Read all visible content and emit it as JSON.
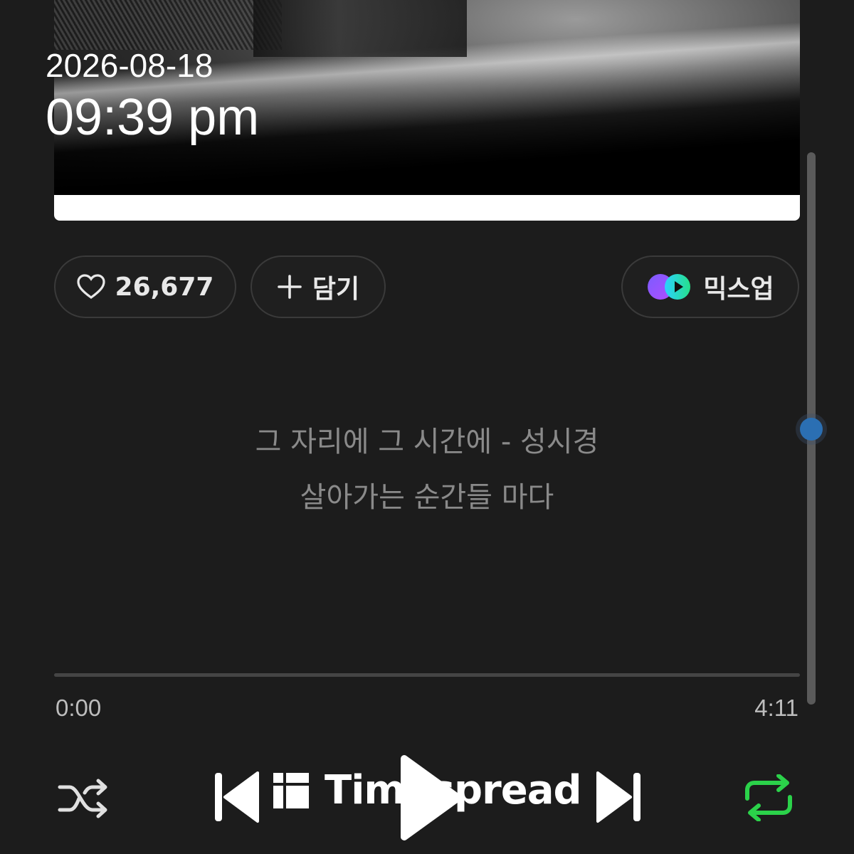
{
  "overlay": {
    "date": "2026-08-18",
    "time": "09:39 pm"
  },
  "actions": {
    "like_count": "26,677",
    "add_label": "담기",
    "mixup_label": "믹스업"
  },
  "lyrics": {
    "line1": "그 자리에 그 시간에 - 성시경",
    "line2": "살아가는 순간들 마다"
  },
  "progress": {
    "elapsed": "0:00",
    "duration": "4:11",
    "fraction": 0
  },
  "watermark": {
    "text": "Timespread"
  },
  "colors": {
    "background": "#1c1c1c",
    "repeat_active": "#2bd24a",
    "scroll_thumb": "#2b6fb3"
  },
  "icons": [
    "heart-icon",
    "plus-icon",
    "mixup-icon",
    "shuffle-icon",
    "previous-icon",
    "play-icon",
    "next-icon",
    "repeat-icon"
  ]
}
